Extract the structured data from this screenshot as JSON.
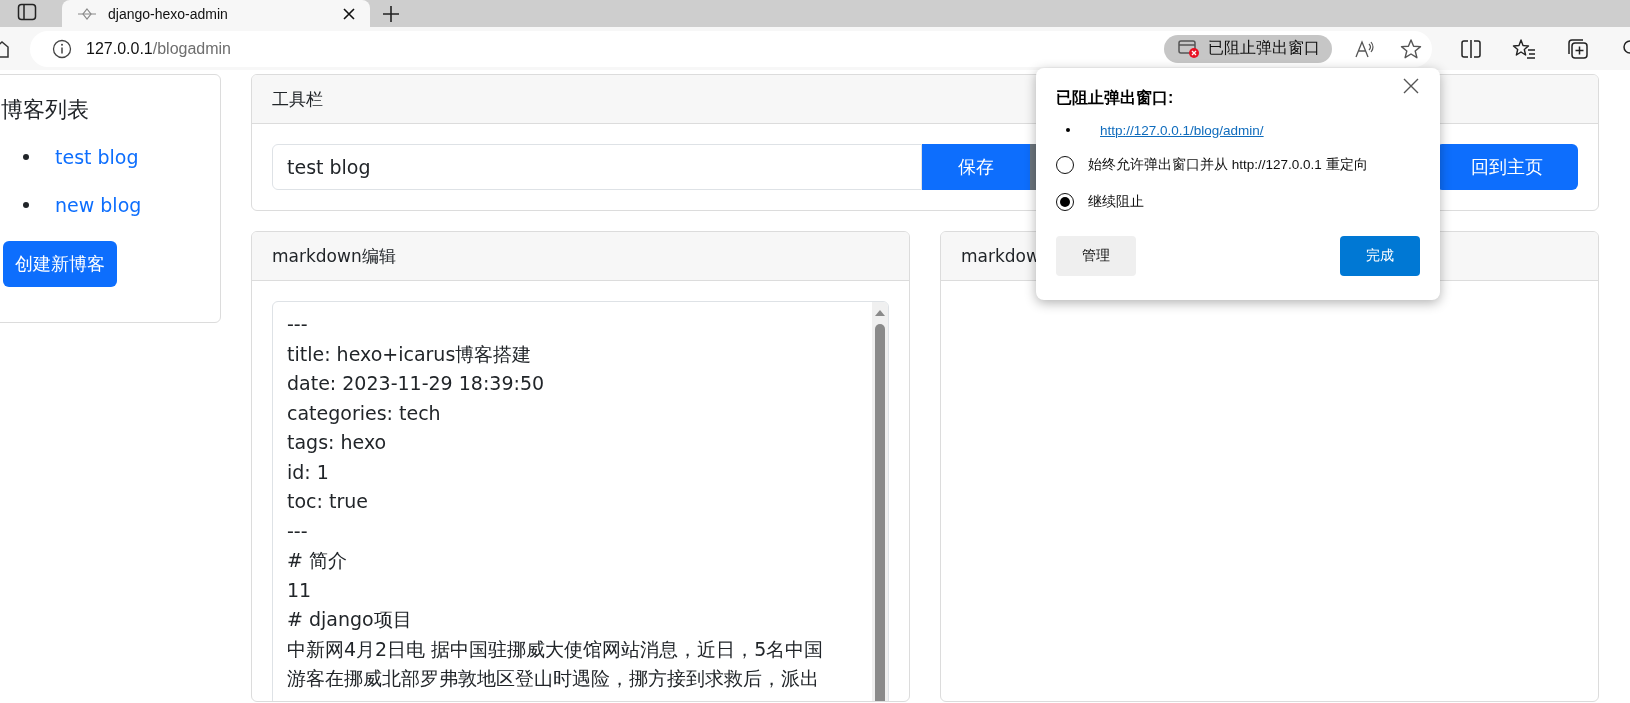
{
  "browser": {
    "tab_title": "django-hexo-admin",
    "address_host": "127.0.0.1",
    "address_path": "/blogadmin",
    "blocked_badge": "已阻止弹出窗口"
  },
  "sidebar": {
    "title": "博客列表",
    "items": [
      {
        "label": "test blog"
      },
      {
        "label": "new blog"
      }
    ],
    "create_button": "创建新博客"
  },
  "toolbar": {
    "title": "工具栏",
    "title_field": "test blog",
    "save_button": "保存",
    "home_button": "回到主页"
  },
  "editor": {
    "title": "markdown编辑",
    "lines": [
      "---",
      "title: hexo+icarus博客搭建",
      "date: 2023-11-29 18:39:50",
      "categories: tech",
      "tags: hexo",
      "id: 1",
      "toc: true",
      "---",
      "# 简介",
      "11",
      "# django项目",
      "中新网4月2日电 据中国驻挪威大使馆网站消息，近日，5名中国",
      "游客在挪威北部罗弗敦地区登山时遇险，挪方接到求救后，派出"
    ]
  },
  "preview": {
    "title": "markdow"
  },
  "popup": {
    "title": "已阻止弹出窗口:",
    "links": [
      "http://127.0.0.1/blog/admin/"
    ],
    "options": [
      {
        "label": "始终允许弹出窗口并从 http://127.0.0.1 重定向",
        "selected": false
      },
      {
        "label": "继续阻止",
        "selected": true
      }
    ],
    "manage_button": "管理",
    "done_button": "完成"
  }
}
